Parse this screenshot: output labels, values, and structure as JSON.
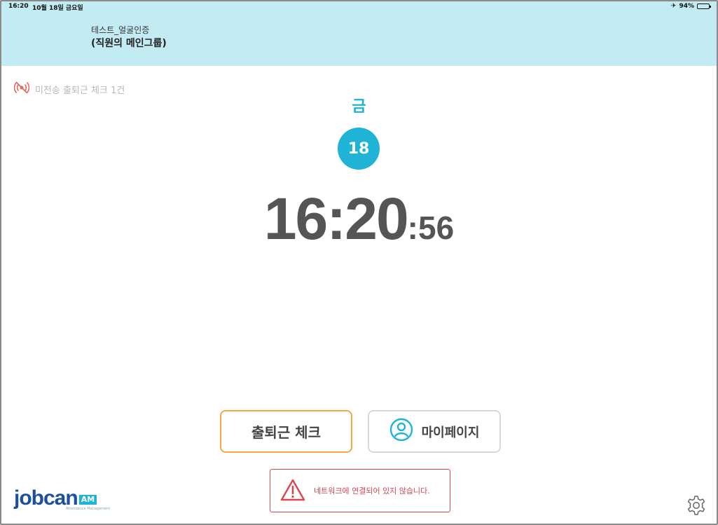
{
  "status_bar": {
    "time": "16:20",
    "date": "10월 18일 금요일",
    "airplane_icon": "airplane-icon",
    "battery": "94%"
  },
  "header": {
    "company": "테스트_얼굴인증",
    "group": "(직원의 메인그룹)"
  },
  "unsent": {
    "icon": "signal-off-icon",
    "label": "미전송 출퇴근 체크 1건"
  },
  "date_display": {
    "weekday": "금",
    "day": "18"
  },
  "clock": {
    "hours_minutes": "16:20",
    "seconds": ":56"
  },
  "buttons": {
    "check_label": "출퇴근 체크",
    "mypage_label": "마이페이지",
    "mypage_icon": "user-circle-icon"
  },
  "alert": {
    "icon": "warning-triangle-icon",
    "message": "네트워크에 연결되어 있지 않습니다."
  },
  "logo": {
    "word": "jobcan",
    "badge": "AM",
    "tagline": "Attendance Management"
  },
  "settings_icon": "gear-icon",
  "colors": {
    "header_bg": "#c3ebf4",
    "accent_blue": "#1fb3d6",
    "check_border": "#f3a843",
    "alert_red": "#d9474f",
    "logo_blue": "#1d4f9b"
  }
}
